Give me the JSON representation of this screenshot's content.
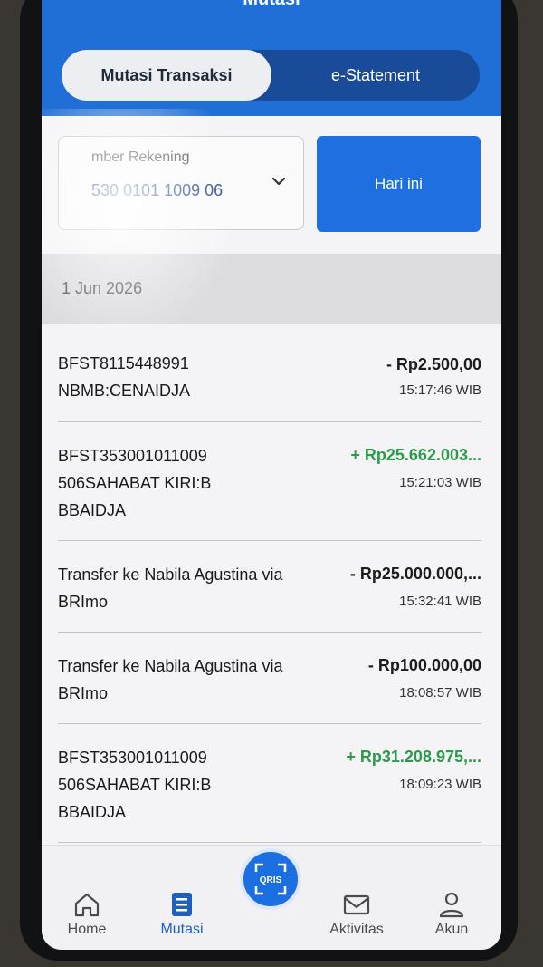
{
  "header": {
    "title": "Mutasi"
  },
  "tabs": [
    {
      "label": "Mutasi Transaksi"
    },
    {
      "label": "e-Statement"
    }
  ],
  "account": {
    "label": "mber Rekening",
    "number": "530 0101 1009 06"
  },
  "filter": {
    "today_label": "Hari ini"
  },
  "date": {
    "label": "1 Jun 2026"
  },
  "transactions": [
    {
      "desc": "BFST8115448991 NBMB:CENAIDJA",
      "amount": "- Rp2.500,00",
      "time": "15:17:46 WIB",
      "type": "debit"
    },
    {
      "desc": "BFST353001011009506SAHABAT KIRI:BBBAIDJA",
      "amount": "+ Rp25.662.003...",
      "time": "15:21:03 WIB",
      "type": "credit"
    },
    {
      "desc": "Transfer ke Nabila Agustina via BRImo",
      "amount": "- Rp25.000.000,...",
      "time": "15:32:41 WIB",
      "type": "debit"
    },
    {
      "desc": "Transfer ke Nabila Agustina via BRImo",
      "amount": "- Rp100.000,00",
      "time": "18:08:57 WIB",
      "type": "debit"
    },
    {
      "desc": "BFST353001011009506SAHABAT KIRI:BBBAIDJA",
      "amount": "+ Rp31.208.975,...",
      "time": "18:09:23 WIB",
      "type": "credit"
    }
  ],
  "nav": {
    "home": "Home",
    "mutasi": "Mutasi",
    "qris": "QRIS",
    "aktivitas": "Aktivitas",
    "akun": "Akun"
  },
  "colors": {
    "header_blue": "#1f6fd6",
    "credit_green": "#2b9a4a",
    "nav_active": "#1f5fbf"
  }
}
